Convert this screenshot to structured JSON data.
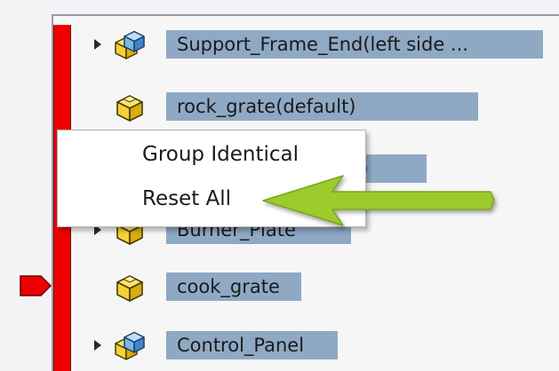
{
  "tree": {
    "rows": [
      {
        "label": "Support_Frame_End(left side ...",
        "icon": "assembly-icon",
        "expandable": true
      },
      {
        "label": "rock_grate(default)",
        "icon": "part-icon",
        "expandable": false
      },
      {
        "label": "ault)",
        "icon": "part-icon",
        "expandable": false
      },
      {
        "label": "Burner_Plate",
        "icon": "part-icon",
        "expandable": true
      },
      {
        "label": "cook_grate",
        "icon": "part-icon",
        "expandable": false
      },
      {
        "label": "Control_Panel",
        "icon": "assembly-icon",
        "expandable": true
      }
    ]
  },
  "context_menu": {
    "items": [
      {
        "label": "Group Identical"
      },
      {
        "label": "Reset All"
      }
    ]
  },
  "annotation": {
    "type": "arrow",
    "color": "#9ccb2e",
    "points_to": "Reset All"
  },
  "colors": {
    "rollback_bar": "#ee0000",
    "selection_highlight": "#8fa9c5",
    "part_yellow": "#f3d23a",
    "assembly_blue": "#79b9e6"
  }
}
